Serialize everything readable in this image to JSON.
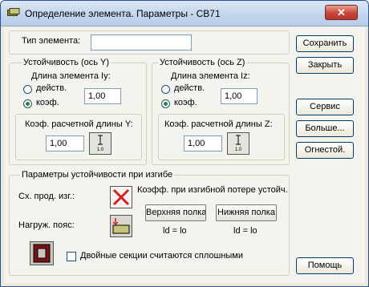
{
  "window": {
    "title": "Определение элемента. Параметры - СВ71"
  },
  "element_type": {
    "label": "Тип элемента:",
    "value": ""
  },
  "stab_y": {
    "title": "Устойчивость (ось Y)",
    "length_label": "Длина элемента Iy:",
    "radio_actual": "действ.",
    "radio_coef": "коэф.",
    "selected": "коэф.",
    "length_value": "1,00",
    "coef_label": "Коэф. расчетной длины Y:",
    "coef_value": "1,00",
    "button_glyph": "1.0"
  },
  "stab_z": {
    "title": "Устойчивость (ось Z)",
    "length_label": "Длина элемента Iz:",
    "radio_actual": "действ.",
    "radio_coef": "коэф.",
    "selected": "коэф.",
    "length_value": "1,00",
    "coef_label": "Коэф. расчетной длины Z:",
    "coef_value": "1,00",
    "button_glyph": "1.0"
  },
  "bending": {
    "title": "Параметры устойчивости при изгибе",
    "scheme_label": "Сх. прод. изг.:",
    "coef_label": "Коэфф. при изгибной потере устойч.",
    "load_label": "Нагруж. пояс:",
    "upper_flange": "Верхняя полка",
    "lower_flange": "Нижняя полка",
    "upper_formula": "ld = lo",
    "lower_formula": "ld = lo",
    "double_sections_label": "Двойные секции считаются сплошными",
    "double_sections_checked": false
  },
  "buttons": {
    "save": "Сохранить",
    "close": "Закрыть",
    "service": "Сервис",
    "more": "Больше...",
    "fire": "Огнестой.",
    "help": "Помощь"
  },
  "colors": {
    "title_bar": "#c2d5ec",
    "close_button": "#c7453a",
    "panel": "#f4f3ee",
    "cross": "#d32020"
  }
}
